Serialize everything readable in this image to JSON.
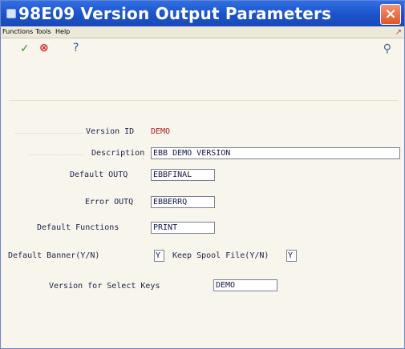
{
  "window": {
    "title": "98E09  Version Output Parameters",
    "close_label": "×"
  },
  "menubar": {
    "items": [
      "Functions",
      "Tools",
      "Help"
    ]
  },
  "toolbar": {
    "ok_icon": "✓",
    "cancel_icon": "⊗",
    "help_icon": "?",
    "search_icon": "⚲"
  },
  "form": {
    "version_id": {
      "label": "Version ID",
      "value": "DEMO"
    },
    "description": {
      "label": "Description",
      "value": "EBB DEMO VERSION"
    },
    "default_outq": {
      "label": "Default OUTQ",
      "value": "EBBFINAL"
    },
    "error_outq": {
      "label": "Error OUTQ",
      "value": "EBBERRQ"
    },
    "default_functions": {
      "label": "Default Functions",
      "value": "PRINT"
    },
    "default_banner": {
      "label": "Default Banner(Y/N)",
      "value": "Y"
    },
    "keep_spool": {
      "label": "Keep Spool File(Y/N)",
      "value": "Y"
    },
    "select_keys": {
      "label": "Version for Select Keys",
      "value": "DEMO"
    }
  }
}
